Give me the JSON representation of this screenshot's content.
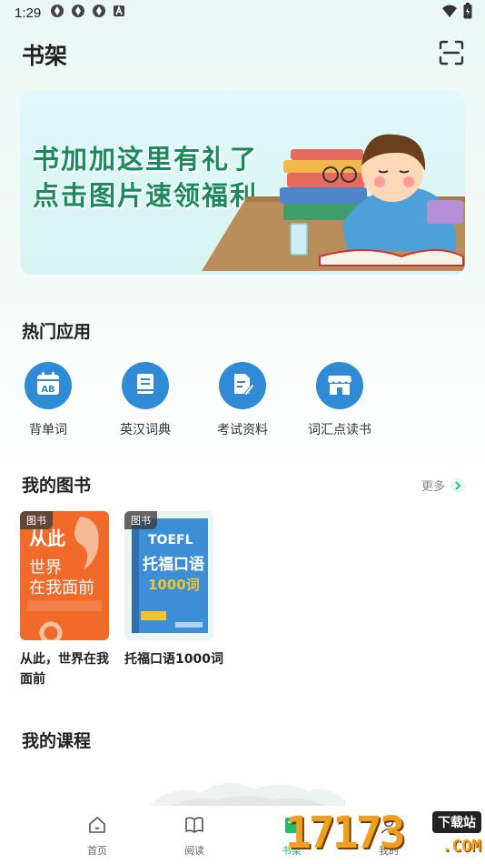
{
  "status_bar": {
    "time": "1:29",
    "left_icons": [
      "app-notification-icon",
      "app-notification-icon",
      "app-notification-icon",
      "a-badge-icon"
    ],
    "right_icons": [
      "wifi-icon",
      "battery-icon"
    ]
  },
  "header": {
    "title": "书架",
    "scan_icon": "scan-icon"
  },
  "banner": {
    "line1": "书加加这里有礼了",
    "line2": "点击图片速领福利"
  },
  "hot_apps": {
    "title": "热门应用",
    "items": [
      {
        "label": "背单词",
        "icon": "calendar-ab-icon"
      },
      {
        "label": "英汉词典",
        "icon": "book-icon"
      },
      {
        "label": "考试资料",
        "icon": "document-pencil-icon"
      },
      {
        "label": "词汇点读书",
        "icon": "store-icon"
      }
    ]
  },
  "my_books": {
    "title": "我的图书",
    "more_label": "更多",
    "items": [
      {
        "tag": "图书",
        "title": "从此，世界在我面前",
        "cover_line1": "从此",
        "cover_line2": "世界",
        "cover_line3": "在我面前",
        "cover_color": "#f26a2a"
      },
      {
        "tag": "图书",
        "title": "托福口语1000词",
        "cover_line1": "TOEFL",
        "cover_line2": "托福口语",
        "cover_line3": "1000词",
        "cover_color": "#3c8fd6"
      }
    ]
  },
  "my_courses": {
    "title": "我的课程"
  },
  "tabbar": {
    "items": [
      {
        "label": "首页",
        "icon": "home-icon"
      },
      {
        "label": "阅读",
        "icon": "open-book-icon"
      },
      {
        "label": "书架",
        "icon": "bookshelf-icon",
        "active": true
      },
      {
        "label": "我的",
        "icon": "profile-icon"
      }
    ],
    "active_color": "#1bbf6b"
  },
  "watermark": {
    "text": "17173",
    "badge": "下载站",
    "suffix": ".COM"
  },
  "colors": {
    "accent_blue": "#2f8bd6",
    "banner_green": "#1c8a5e"
  }
}
